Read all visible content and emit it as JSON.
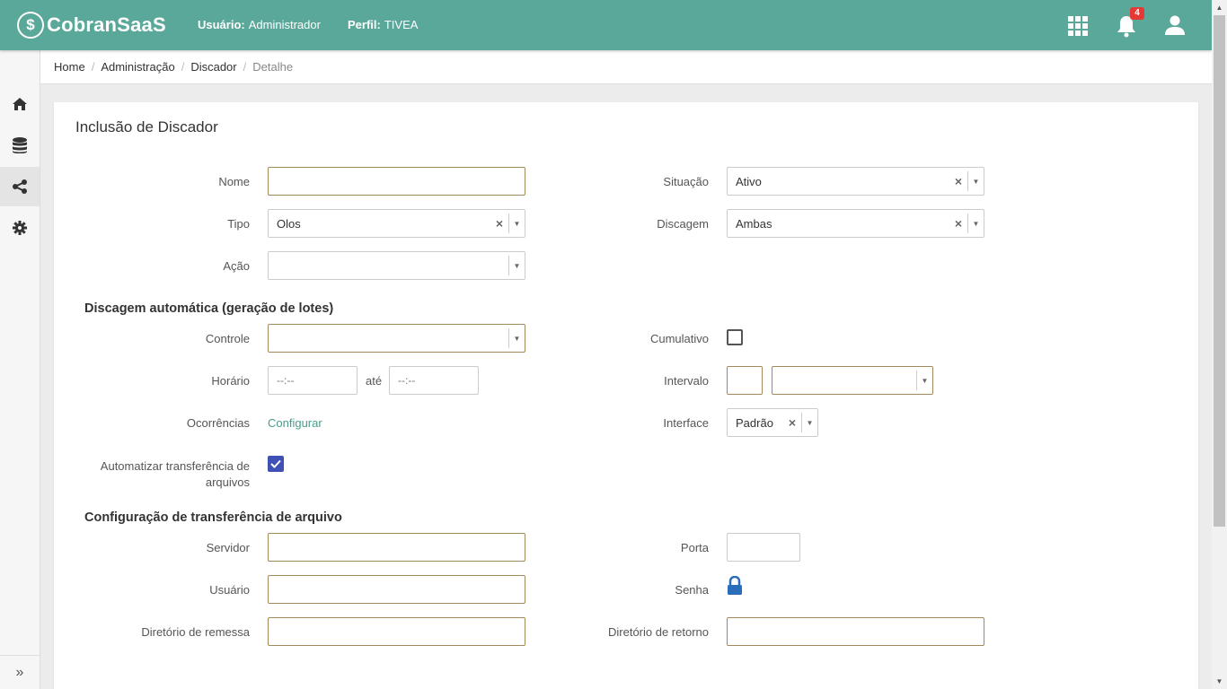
{
  "header": {
    "brand": "CobranSaaS",
    "user_label": "Usuário:",
    "user_value": "Administrador",
    "profile_label": "Perfil:",
    "profile_value": "TIVEA",
    "notification_count": "4"
  },
  "sidebar": {
    "items": [
      "home-icon",
      "database-icon",
      "share-icon",
      "gear-icon"
    ],
    "expand_glyph": "»"
  },
  "breadcrumb": [
    "Home",
    "Administração",
    "Discador",
    "Detalhe"
  ],
  "page": {
    "title": "Inclusão de Discador"
  },
  "form": {
    "nome_label": "Nome",
    "nome_value": "",
    "situacao_label": "Situação",
    "situacao_value": "Ativo",
    "tipo_label": "Tipo",
    "tipo_value": "Olos",
    "discagem_label": "Discagem",
    "discagem_value": "Ambas",
    "acao_label": "Ação",
    "acao_value": ""
  },
  "auto": {
    "section_title": "Discagem automática (geração de lotes)",
    "controle_label": "Controle",
    "controle_value": "",
    "cumulativo_label": "Cumulativo",
    "horario_label": "Horário",
    "horario_inicio": "--:--",
    "ate_label": "até",
    "horario_fim": "--:--",
    "intervalo_label": "Intervalo",
    "ocorrencias_label": "Ocorrências",
    "configurar_link": "Configurar",
    "interface_label": "Interface",
    "interface_value": "Padrão",
    "automatizar_label_1": "Automatizar transferência de",
    "automatizar_label_2": "arquivos"
  },
  "transfer": {
    "section_title": "Configuração de transferência de arquivo",
    "servidor_label": "Servidor",
    "porta_label": "Porta",
    "usuario_label": "Usuário",
    "senha_label": "Senha",
    "dir_remessa_label": "Diretório de remessa",
    "dir_retorno_label": "Diretório de retorno"
  },
  "colors": {
    "header": "#5aa89a",
    "accent_link": "#4a9d8e",
    "checkbox_checked": "#3f51b5",
    "lock_icon": "#2a6ebb",
    "badge": "#e53935"
  }
}
